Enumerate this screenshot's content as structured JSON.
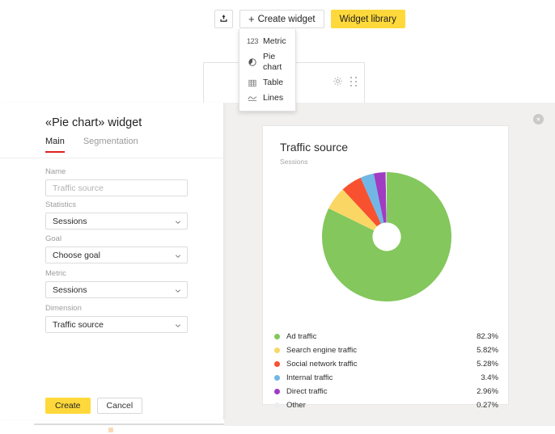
{
  "toolbar": {
    "export_icon": "upload-icon",
    "create_widget_label": "Create widget",
    "create_widget_plus": "+",
    "widget_library_label": "Widget library",
    "widget_library_color": "#ffd93b"
  },
  "dropdown": {
    "items": [
      {
        "label": "Metric",
        "icon": "number-123-icon",
        "glyph": "123"
      },
      {
        "label": "Pie chart",
        "icon": "pie-chart-icon"
      },
      {
        "label": "Table",
        "icon": "table-grid-icon"
      },
      {
        "label": "Lines",
        "icon": "line-chart-icon"
      }
    ]
  },
  "background_card": {
    "settings_icon": "gear-icon",
    "drag_icon": "drag-handle-icon"
  },
  "panel": {
    "title": "«Pie chart» widget",
    "tabs": [
      {
        "label": "Main",
        "active": true
      },
      {
        "label": "Segmentation",
        "active": false
      }
    ],
    "fields": [
      {
        "label": "Name",
        "value": "Traffic source",
        "type": "text",
        "placeholder": true
      },
      {
        "label": "Statistics",
        "value": "Sessions",
        "type": "select",
        "placeholder": false
      },
      {
        "label": "Goal",
        "value": "Choose goal",
        "type": "select",
        "placeholder": false
      },
      {
        "label": "Metric",
        "value": "Sessions",
        "type": "select",
        "placeholder": false
      },
      {
        "label": "Dimension",
        "value": "Traffic source",
        "type": "select",
        "placeholder": false
      }
    ],
    "create_label": "Create",
    "cancel_label": "Cancel",
    "create_color": "#ffd93b",
    "active_tab_underline_color": "#e02020"
  },
  "preview": {
    "close_icon": "close-icon",
    "background_color": "#f1f0ee"
  },
  "chart_data": {
    "type": "pie",
    "title": "Traffic source",
    "subtitle": "Sessions",
    "unit": "%",
    "hole": 0.22,
    "start_angle": -90,
    "legend_position": "bottom",
    "categories": [
      "Ad traffic",
      "Search engine traffic",
      "Social network traffic",
      "Internal traffic",
      "Direct traffic",
      "Other"
    ],
    "values": [
      82.3,
      5.82,
      5.28,
      3.4,
      2.96,
      0.27
    ],
    "value_labels": [
      "82.3%",
      "5.82%",
      "5.28%",
      "3.4%",
      "2.96%",
      "0.27%"
    ],
    "colors": [
      "#83c75d",
      "#fad764",
      "#f8512f",
      "#71b7e6",
      "#a03cc1",
      "#ededed"
    ]
  }
}
